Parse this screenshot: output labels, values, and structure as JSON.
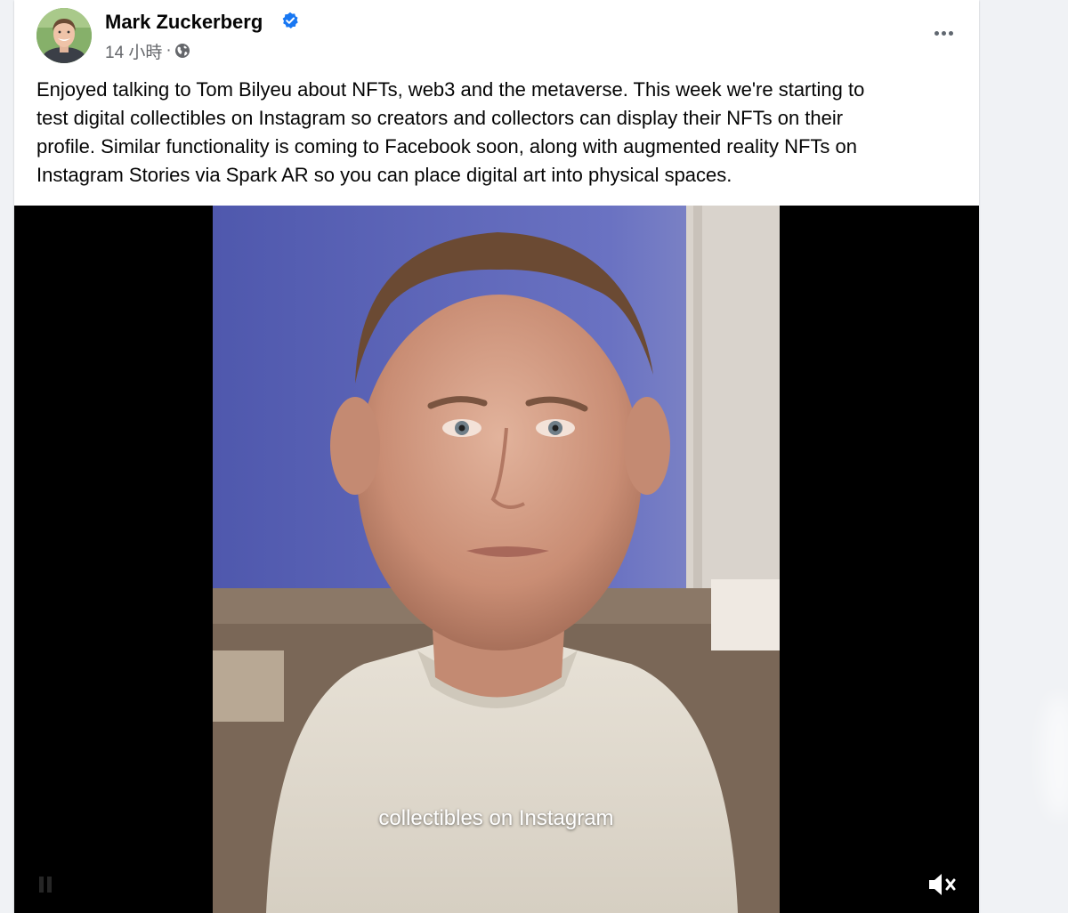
{
  "post": {
    "author": "Mark Zuckerberg",
    "verified": true,
    "time": "14 小時",
    "separator": "·",
    "visibility_icon": "globe-icon",
    "more_icon": "more-horizontal-icon",
    "text": "Enjoyed talking to Tom Bilyeu about NFTs, web3 and the metaverse. This week we're starting to\ntest digital collectibles on Instagram so creators and collectors can display their NFTs on their\nprofile. Similar functionality is coming to Facebook soon, along with augmented reality NFTs on\nInstagram Stories via Spark AR so you can place digital art into physical spaces."
  },
  "video": {
    "caption": "collectibles on Instagram",
    "mute_icon": "volume-muted-icon"
  },
  "colors": {
    "page_background": "#f0f2f5",
    "card_background": "#ffffff",
    "text_primary": "#050505",
    "text_secondary": "#65676b",
    "verified_blue": "#1877f2",
    "video_background": "#000000"
  }
}
